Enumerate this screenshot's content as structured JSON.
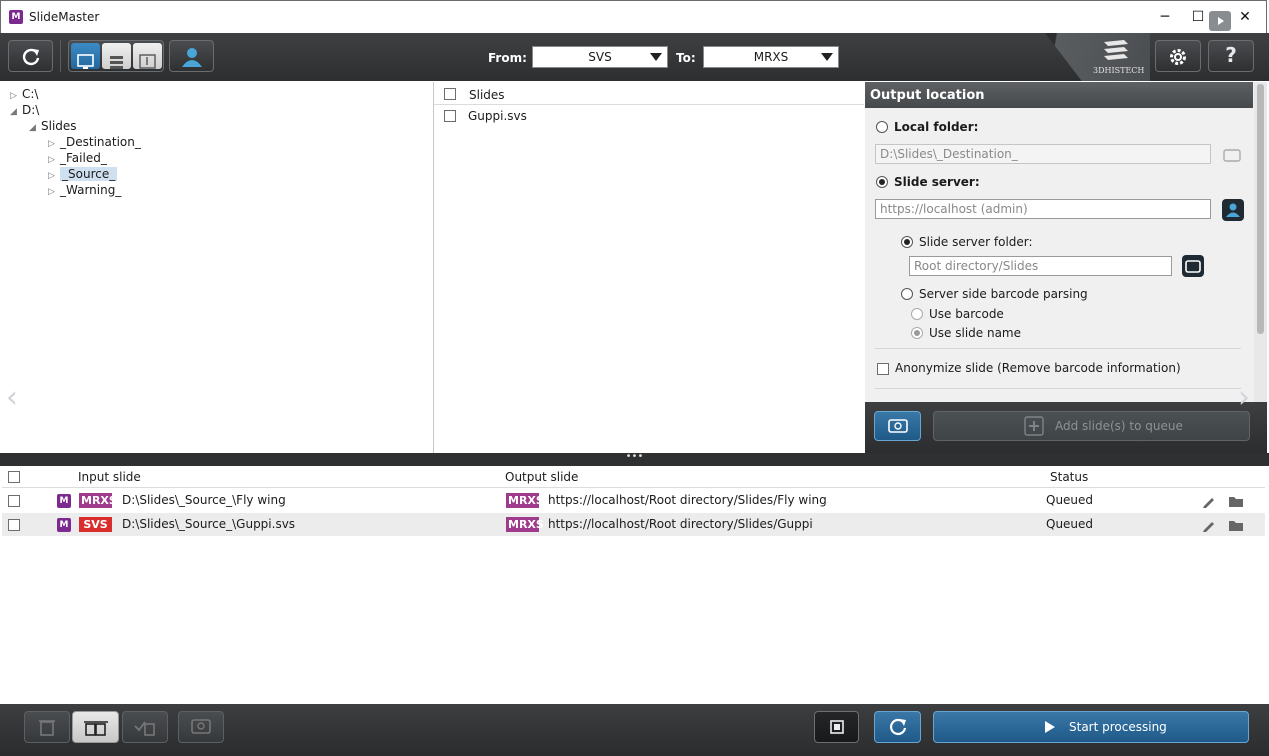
{
  "window": {
    "title": "SlideMaster",
    "min_glyph": "─",
    "max_glyph": "☐",
    "close_glyph": "✕"
  },
  "toolbar": {
    "from_label": "From:",
    "from_value": "SVS",
    "to_label": "To:",
    "to_value": "MRXS",
    "brand": "3DHISTECH"
  },
  "tree": {
    "items": [
      {
        "label": "C:\\",
        "level": 0,
        "toggle": "▷"
      },
      {
        "label": "D:\\",
        "level": 0,
        "toggle": "◢"
      },
      {
        "label": "Slides",
        "level": 1,
        "toggle": "◢"
      },
      {
        "label": "_Destination_",
        "level": 2,
        "toggle": "▷"
      },
      {
        "label": "_Failed_",
        "level": 2,
        "toggle": "▷"
      },
      {
        "label": "_Source_",
        "level": 2,
        "toggle": "▷",
        "selected": true
      },
      {
        "label": "_Warning_",
        "level": 2,
        "toggle": "▷"
      }
    ]
  },
  "slide_list": {
    "header": "Slides",
    "items": [
      "Guppi.svs"
    ]
  },
  "output": {
    "title": "Output location",
    "local_folder_label": "Local folder:",
    "local_folder_value": "D:\\Slides\\_Destination_",
    "slide_server_label": "Slide server:",
    "slide_server_value": "https://localhost (admin)",
    "server_folder_label": "Slide server folder:",
    "server_folder_value": "Root directory/Slides",
    "barcode_parsing_label": "Server side barcode parsing",
    "use_barcode_label": "Use barcode",
    "use_slide_name_label": "Use slide name",
    "anonymize_label": "Anonymize slide (Remove barcode information)",
    "add_queue_label": "Add slide(s) to queue"
  },
  "splitter": {
    "grip": "•••"
  },
  "queue": {
    "columns": {
      "input": "Input slide",
      "output": "Output slide",
      "status": "Status"
    },
    "rows": [
      {
        "in_format": "MRXS",
        "input": "D:\\Slides\\_Source_\\Fly wing",
        "out_format": "MRXS",
        "output": "https://localhost/Root directory/Slides/Fly wing",
        "status": "Queued"
      },
      {
        "in_format": "SVS",
        "input": "D:\\Slides\\_Source_\\Guppi.svs",
        "out_format": "MRXS",
        "output": "https://localhost/Root directory/Slides/Guppi",
        "status": "Queued"
      }
    ]
  },
  "bottom": {
    "start_label": "Start processing"
  },
  "colors": {
    "accent": "#2a6ea6",
    "mrxs": "#a03a8c",
    "svs": "#d82e2e",
    "toolbar": "#333537"
  }
}
